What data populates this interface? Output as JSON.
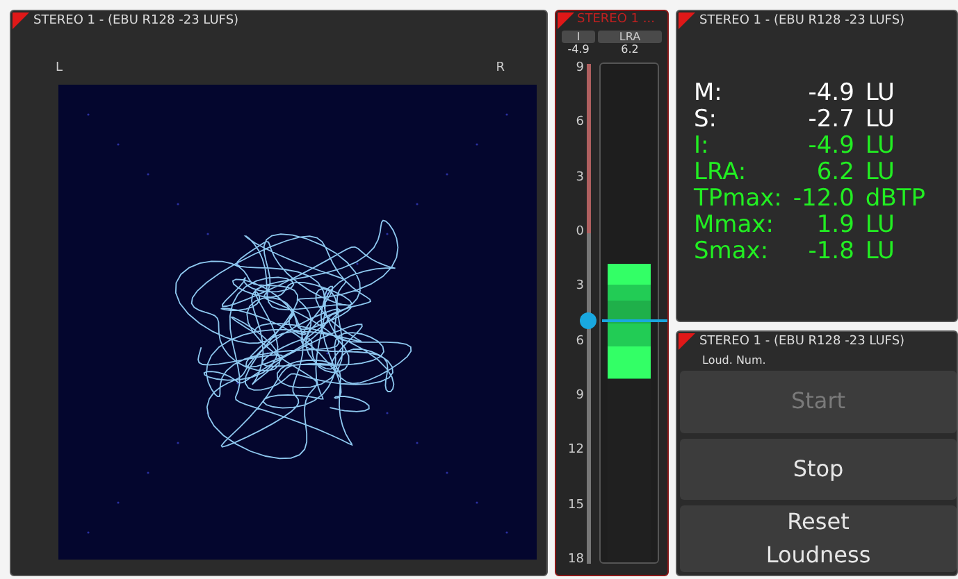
{
  "goniometer": {
    "title": "STEREO 1 - (EBU R128 -23 LUFS)",
    "left_label": "L",
    "right_label": "R"
  },
  "meter": {
    "title": "STEREO 1 ...",
    "headers": [
      "I",
      "LRA"
    ],
    "readings": [
      "-4.9",
      "6.2"
    ],
    "scale": [
      "9",
      "6",
      "3",
      "0",
      "3",
      "6",
      "9",
      "12",
      "15",
      "18"
    ],
    "lra_bar": {
      "top": {
        "level": 0.6
      },
      "bottom": {
        "level": 0.37
      }
    },
    "integrated": {
      "level": 0.487
    }
  },
  "readouts": {
    "title": "STEREO 1 - (EBU R128 -23 LUFS)",
    "rows": [
      {
        "label": "M:",
        "value": "-4.9",
        "unit": "LU",
        "color": "#ffffff"
      },
      {
        "label": "S:",
        "value": "-2.7",
        "unit": "LU",
        "color": "#ffffff"
      },
      {
        "label": "I:",
        "value": "-4.9",
        "unit": "LU",
        "color": "#22ee22"
      },
      {
        "label": "LRA:",
        "value": "6.2",
        "unit": "LU",
        "color": "#22ee22"
      },
      {
        "label": "TPmax:",
        "value": "-12.0",
        "unit": "dBTP",
        "color": "#22ee22"
      },
      {
        "label": "Mmax:",
        "value": "1.9",
        "unit": "LU",
        "color": "#22ee22"
      },
      {
        "label": "Smax:",
        "value": "-1.8",
        "unit": "LU",
        "color": "#22ee22"
      }
    ]
  },
  "controls": {
    "title": "STEREO 1 - (EBU R128 -23 LUFS)",
    "subtitle": "Loud. Num.",
    "buttons": [
      {
        "label": "Start",
        "disabled": true
      },
      {
        "label": "Stop",
        "disabled": false
      },
      {
        "label": "Reset Loudness",
        "disabled": false
      }
    ]
  }
}
